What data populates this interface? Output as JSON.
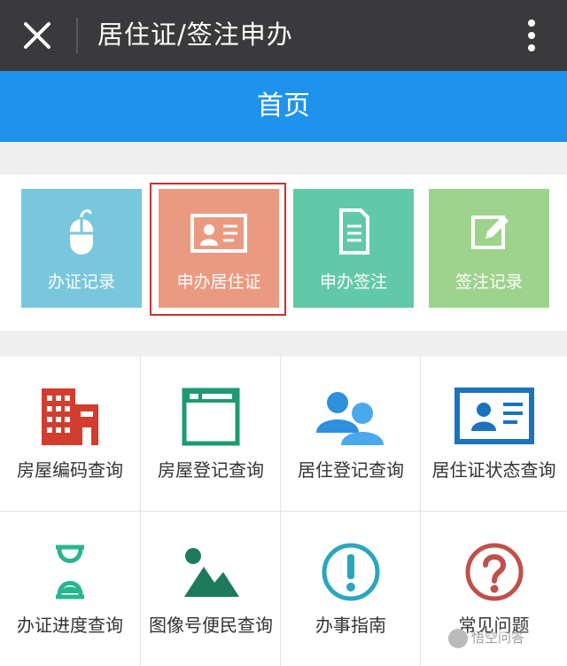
{
  "topbar": {
    "title": "居住证/签注申办"
  },
  "navbar": {
    "title": "首页"
  },
  "tiles": [
    {
      "label": "办证记录",
      "icon": "mouse-icon",
      "color": "#79c7dd"
    },
    {
      "label": "申办居住证",
      "icon": "id-card-icon",
      "color": "#eb9a82"
    },
    {
      "label": "申办签注",
      "icon": "document-icon",
      "color": "#62c9a8"
    },
    {
      "label": "签注记录",
      "icon": "edit-icon",
      "color": "#9ed38d"
    }
  ],
  "grid": [
    {
      "label": "房屋编码查询",
      "icon": "building-icon",
      "color": "#d23d2d"
    },
    {
      "label": "房屋登记查询",
      "icon": "window-icon",
      "color": "#1d9a70"
    },
    {
      "label": "居住登记查询",
      "icon": "users-icon",
      "color": "#2e8fdc"
    },
    {
      "label": "居住证状态查询",
      "icon": "id-card-icon",
      "color": "#1a73be"
    },
    {
      "label": "办证进度查询",
      "icon": "hourglass-icon",
      "color": "#28b592"
    },
    {
      "label": "图像号便民查询",
      "icon": "image-icon",
      "color": "#1d7a5a"
    },
    {
      "label": "办事指南",
      "icon": "exclamation-icon",
      "color": "#2aa6bd"
    },
    {
      "label": "常见问题",
      "icon": "question-icon",
      "color": "#c0504a"
    }
  ],
  "watermark": {
    "text": "悟空问答"
  }
}
